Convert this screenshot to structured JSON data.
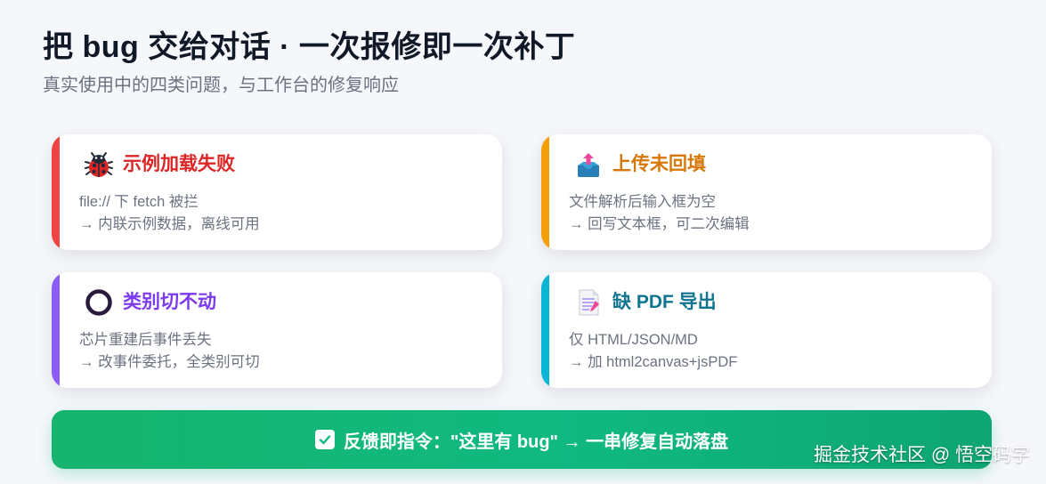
{
  "header": {
    "title": "把 bug 交给对话 · 一次报修即一次补丁",
    "subtitle": "真实使用中的四类问题，与工作台的修复响应"
  },
  "cards": [
    {
      "icon": "ladybug-icon",
      "accent": "#ef4444",
      "title_color": "#dc2626",
      "title": "示例加载失败",
      "problem": "file:// 下 fetch 被拦",
      "fix": "→ 内联示例数据，离线可用"
    },
    {
      "icon": "upload-tray-icon",
      "accent": "#f59e0b",
      "title_color": "#d97706",
      "title": "上传未回填",
      "problem": "文件解析后输入框为空",
      "fix": "→ 回写文本框，可二次编辑"
    },
    {
      "icon": "ring-icon",
      "accent": "#8b5cf6",
      "title_color": "#7c3aed",
      "title": "类别切不动",
      "problem": "芯片重建后事件丢失",
      "fix": "→ 改事件委托，全类别可切"
    },
    {
      "icon": "document-icon",
      "accent": "#06b6d4",
      "title_color": "#0e7490",
      "title": "缺 PDF 导出",
      "problem": "仅 HTML/JSON/MD",
      "fix": "→ 加 html2canvas+jsPDF"
    }
  ],
  "footer": {
    "icon": "check-icon",
    "text": "反馈即指令：\"这里有 bug\" → 一串修复自动落盘",
    "color": "#10b981"
  },
  "watermark": {
    "text": "掘金技术社区 @ 悟空码字"
  }
}
